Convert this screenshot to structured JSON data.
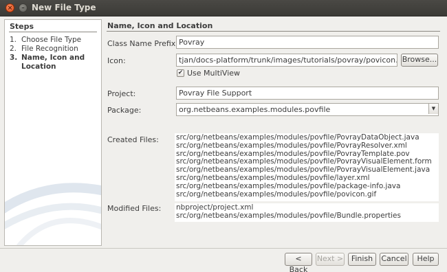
{
  "window": {
    "title": "New File Type"
  },
  "sidebar": {
    "title": "Steps",
    "steps": [
      {
        "num": "1.",
        "label": "Choose File Type",
        "current": false
      },
      {
        "num": "2.",
        "label": "File Recognition",
        "current": false
      },
      {
        "num": "3.",
        "label": "Name, Icon and Location",
        "current": true
      }
    ]
  },
  "main": {
    "title": "Name, Icon and Location",
    "class_name_prefix": {
      "label": "Class Name Prefix:",
      "value": "Povray"
    },
    "icon": {
      "label": "Icon:",
      "value": "tjan/docs-platform/trunk/images/tutorials/povray/povicon.gif",
      "browse_label": "Browse..."
    },
    "use_multiview": {
      "label": "Use MultiView",
      "checked": true
    },
    "project": {
      "label": "Project:",
      "value": "Povray File Support"
    },
    "package": {
      "label": "Package:",
      "value": "org.netbeans.examples.modules.povfile"
    },
    "created_files": {
      "label": "Created Files:",
      "files": [
        "src/org/netbeans/examples/modules/povfile/PovrayDataObject.java",
        "src/org/netbeans/examples/modules/povfile/PovrayResolver.xml",
        "src/org/netbeans/examples/modules/povfile/PovrayTemplate.pov",
        "src/org/netbeans/examples/modules/povfile/PovrayVisualElement.form",
        "src/org/netbeans/examples/modules/povfile/PovrayVisualElement.java",
        "src/org/netbeans/examples/modules/povfile/layer.xml",
        "src/org/netbeans/examples/modules/povfile/package-info.java",
        "src/org/netbeans/examples/modules/povfile/povicon.gif"
      ]
    },
    "modified_files": {
      "label": "Modified Files:",
      "files": [
        "nbproject/project.xml",
        "src/org/netbeans/examples/modules/povfile/Bundle.properties"
      ]
    }
  },
  "footer": {
    "back_label": "< Back",
    "next_label": "Next >",
    "finish_label": "Finish",
    "cancel_label": "Cancel",
    "help_label": "Help"
  },
  "icons": {
    "close": "close-icon",
    "minimize": "minimize-icon",
    "dropdown": "dropdown-arrow-icon",
    "check": "checkmark-icon"
  }
}
